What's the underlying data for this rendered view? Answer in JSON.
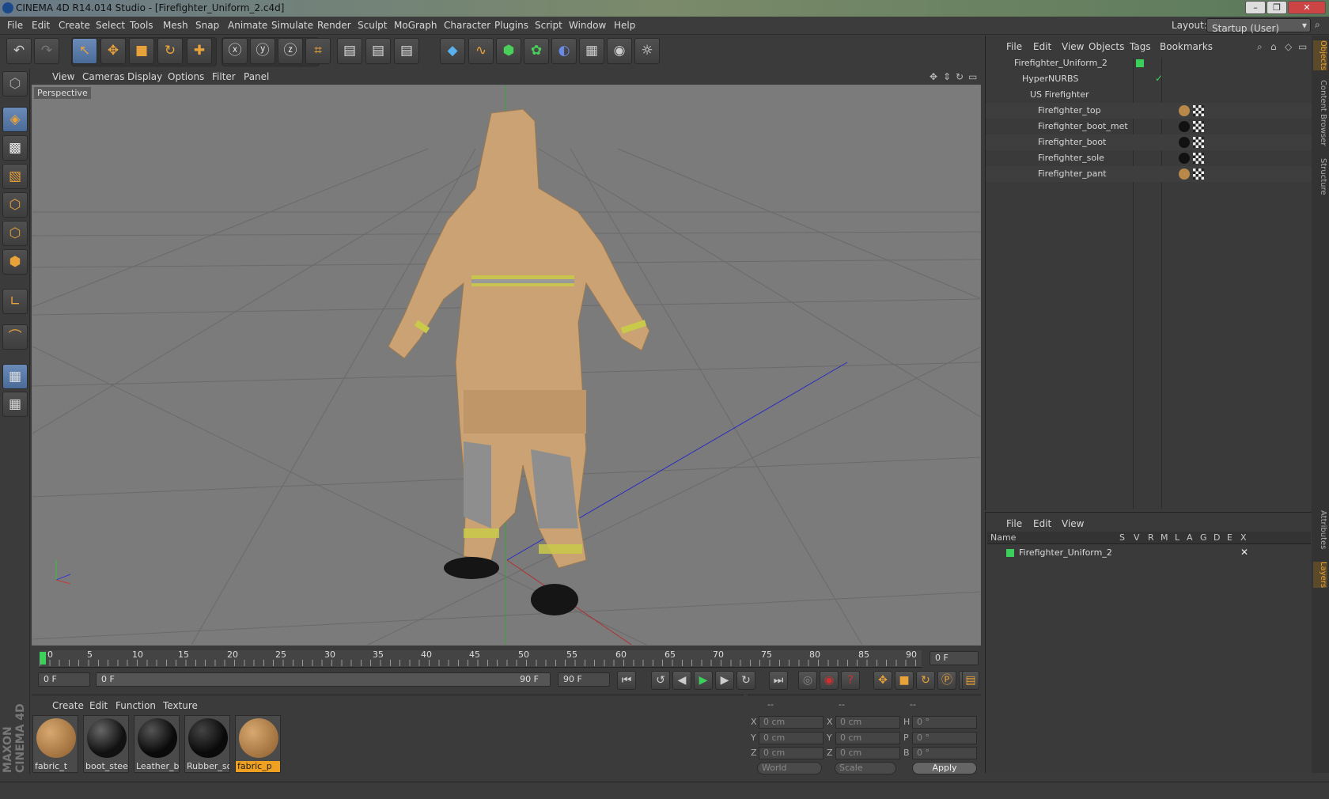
{
  "window": {
    "title": "CINEMA 4D R14.014 Studio - [Firefighter_Uniform_2.c4d]"
  },
  "menu": [
    "File",
    "Edit",
    "Create",
    "Select",
    "Tools",
    "Mesh",
    "Snap",
    "Animate",
    "Simulate",
    "Render",
    "Sculpt",
    "MoGraph",
    "Character",
    "Plugins",
    "Script",
    "Window",
    "Help"
  ],
  "layout": {
    "label": "Layout:",
    "value": "Startup (User)"
  },
  "viewport": {
    "menu": [
      "View",
      "Cameras",
      "Display",
      "Options",
      "Filter",
      "Panel"
    ],
    "label": "Perspective"
  },
  "timeline": {
    "ticks": [
      "0",
      "5",
      "10",
      "15",
      "20",
      "25",
      "30",
      "35",
      "40",
      "45",
      "50",
      "55",
      "60",
      "65",
      "70",
      "75",
      "80",
      "85",
      "90"
    ],
    "current_frame": "0 F",
    "start": "0 F",
    "range_start": "0 F",
    "range_end": "90 F",
    "end": "90 F"
  },
  "materials": {
    "menu": [
      "Create",
      "Edit",
      "Function",
      "Texture"
    ],
    "items": [
      {
        "name": "fabric_t",
        "color": "#b8874a"
      },
      {
        "name": "boot_steel",
        "color": "#1a1a1a"
      },
      {
        "name": "Leather_bo",
        "color": "#111111"
      },
      {
        "name": "Rubber_so",
        "color": "#151515"
      },
      {
        "name": "fabric_p",
        "color": "#b8874a",
        "selected": true
      }
    ]
  },
  "coords": {
    "headers": [
      "--",
      "--",
      "--"
    ],
    "rows": [
      {
        "a": "X",
        "av": "0 cm",
        "b": "X",
        "bv": "0 cm",
        "c": "H",
        "cv": "0 °"
      },
      {
        "a": "Y",
        "av": "0 cm",
        "b": "Y",
        "bv": "0 cm",
        "c": "P",
        "cv": "0 °"
      },
      {
        "a": "Z",
        "av": "0 cm",
        "b": "Z",
        "bv": "0 cm",
        "c": "B",
        "cv": "0 °"
      }
    ],
    "mode1": "World",
    "mode2": "Scale",
    "apply": "Apply"
  },
  "objects": {
    "menu": [
      "File",
      "Edit",
      "View",
      "Objects",
      "Tags",
      "Bookmarks"
    ],
    "tree": [
      {
        "name": "Firefighter_Uniform_2",
        "indent": 0
      },
      {
        "name": "HyperNURBS",
        "indent": 1
      },
      {
        "name": "US Firefighter",
        "indent": 2
      },
      {
        "name": "Firefighter_top",
        "indent": 3
      },
      {
        "name": "Firefighter_boot_met",
        "indent": 3
      },
      {
        "name": "Firefighter_boot",
        "indent": 3
      },
      {
        "name": "Firefighter_sole",
        "indent": 3
      },
      {
        "name": "Firefighter_pant",
        "indent": 3
      }
    ]
  },
  "layers": {
    "menu": [
      "File",
      "Edit",
      "View"
    ],
    "header_name": "Name",
    "flags": [
      "S",
      "V",
      "R",
      "M",
      "L",
      "A",
      "G",
      "D",
      "E",
      "X"
    ],
    "rows": [
      {
        "name": "Firefighter_Uniform_2"
      }
    ]
  },
  "sidetabs": [
    "Objects",
    "Content Browser",
    "Structure",
    "Attributes",
    "Layers"
  ],
  "brand": "MAXON CINEMA 4D"
}
